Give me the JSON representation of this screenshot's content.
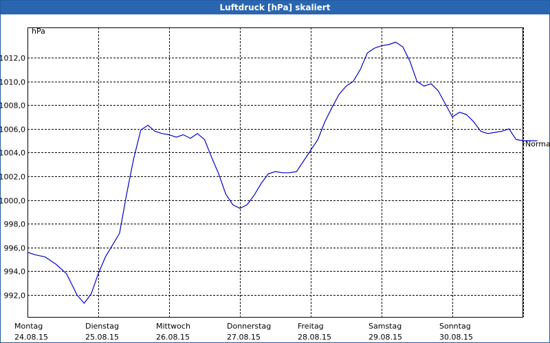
{
  "window": {
    "title": "Luftdruck [hPa] skaliert"
  },
  "chart_data": {
    "type": "line",
    "title": "Luftdruck [hPa] skaliert",
    "ylabel": "hPa",
    "xlabel": "",
    "ylim": [
      990.0,
      1014.0
    ],
    "yticks": [
      "992,0",
      "994,0",
      "996,0",
      "998,0",
      "1000,0",
      "1002,0",
      "1004,0",
      "1006,0",
      "1008,0",
      "1010,0",
      "1012,0"
    ],
    "ytick_values": [
      992,
      994,
      996,
      998,
      1000,
      1002,
      1004,
      1006,
      1008,
      1010,
      1012
    ],
    "xticks": [
      {
        "day": "Montag",
        "date": "24.08.15"
      },
      {
        "day": "Dienstag",
        "date": "25.08.15"
      },
      {
        "day": "Mittwoch",
        "date": "26.08.15"
      },
      {
        "day": "Donnerstag",
        "date": "27.08.15"
      },
      {
        "day": "Freitag",
        "date": "28.08.15"
      },
      {
        "day": "Samstag",
        "date": "29.08.15"
      },
      {
        "day": "Sonntag",
        "date": "30.08.15"
      }
    ],
    "reference_line": {
      "label": "Normal",
      "value": 1004.8
    },
    "grid": true,
    "series": [
      {
        "color": "#0000c8",
        "x_days": [
          0.0,
          0.1,
          0.25,
          0.4,
          0.55,
          0.7,
          0.8,
          0.9,
          1.0,
          1.1,
          1.2,
          1.3,
          1.4,
          1.5,
          1.6,
          1.7,
          1.8,
          1.9,
          2.0,
          2.1,
          2.2,
          2.3,
          2.4,
          2.5,
          2.6,
          2.7,
          2.8,
          2.9,
          3.0,
          3.1,
          3.2,
          3.3,
          3.4,
          3.5,
          3.6,
          3.7,
          3.8,
          3.9,
          4.0,
          4.1,
          4.2,
          4.3,
          4.4,
          4.5,
          4.6,
          4.7,
          4.8,
          4.9,
          5.0,
          5.1,
          5.2,
          5.3,
          5.4,
          5.5,
          5.6,
          5.7,
          5.8,
          5.9,
          6.0,
          6.1,
          6.2,
          6.3,
          6.4,
          6.5,
          6.6,
          6.7,
          6.8,
          6.9,
          7.0,
          7.1,
          7.2
        ],
        "values": [
          995.6,
          995.4,
          995.2,
          994.6,
          993.8,
          992.0,
          991.3,
          992.1,
          993.8,
          995.2,
          996.2,
          997.2,
          1000.5,
          1003.5,
          1005.9,
          1006.3,
          1005.8,
          1005.6,
          1005.5,
          1005.3,
          1005.5,
          1005.2,
          1005.6,
          1005.1,
          1003.6,
          1002.2,
          1000.5,
          999.6,
          999.3,
          999.6,
          1000.4,
          1001.4,
          1002.2,
          1002.4,
          1002.3,
          1002.3,
          1002.4,
          1003.3,
          1004.2,
          1005.1,
          1006.6,
          1007.8,
          1008.9,
          1009.6,
          1010.0,
          1011.0,
          1012.4,
          1012.8,
          1013.0,
          1013.1,
          1013.3,
          1012.9,
          1011.7,
          1010.0,
          1009.6,
          1009.8,
          1009.2,
          1008.1,
          1007.0,
          1007.4,
          1007.2,
          1006.6,
          1005.8,
          1005.6,
          1005.7,
          1005.8,
          1006.0,
          1005.1,
          1005.0,
          1005.0,
          1005.0
        ]
      }
    ]
  }
}
